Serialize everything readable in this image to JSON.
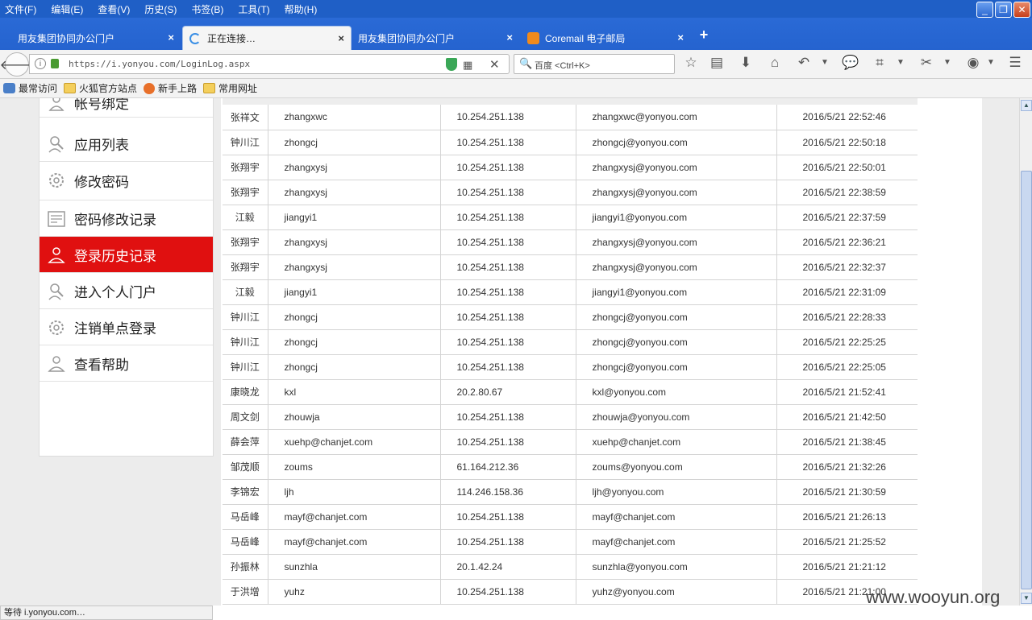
{
  "menu": [
    "文件(F)",
    "编辑(E)",
    "查看(V)",
    "历史(S)",
    "书签(B)",
    "工具(T)",
    "帮助(H)"
  ],
  "tabs": [
    {
      "label": "用友集团协同办公门户"
    },
    {
      "label": "正在连接…"
    },
    {
      "label": "用友集团协同办公门户"
    },
    {
      "label": "Coremail 电子邮局"
    }
  ],
  "tab_close": "×",
  "new_tab": "+",
  "nav": {
    "url": "https://i.yonyou.com/LoginLog.aspx",
    "search_placeholder": "百度 <Ctrl+K>"
  },
  "bookmarks": [
    "最常访问",
    "火狐官方站点",
    "新手上路",
    "常用网址"
  ],
  "sidebar": [
    {
      "label": "帐号绑定"
    },
    {
      "label": "应用列表"
    },
    {
      "label": "修改密码"
    },
    {
      "label": "密码修改记录"
    },
    {
      "label": "登录历史记录",
      "active": true
    },
    {
      "label": "进入个人门户"
    },
    {
      "label": "注销单点登录"
    },
    {
      "label": "查看帮助"
    }
  ],
  "log_rows": [
    [
      "张祥文",
      "zhangxwc",
      "10.254.251.138",
      "zhangxwc@yonyou.com",
      "2016/5/21 22:52:46"
    ],
    [
      "钟川江",
      "zhongcj",
      "10.254.251.138",
      "zhongcj@yonyou.com",
      "2016/5/21 22:50:18"
    ],
    [
      "张翔宇",
      "zhangxysj",
      "10.254.251.138",
      "zhangxysj@yonyou.com",
      "2016/5/21 22:50:01"
    ],
    [
      "张翔宇",
      "zhangxysj",
      "10.254.251.138",
      "zhangxysj@yonyou.com",
      "2016/5/21 22:38:59"
    ],
    [
      "江毅",
      "jiangyi1",
      "10.254.251.138",
      "jiangyi1@yonyou.com",
      "2016/5/21 22:37:59"
    ],
    [
      "张翔宇",
      "zhangxysj",
      "10.254.251.138",
      "zhangxysj@yonyou.com",
      "2016/5/21 22:36:21"
    ],
    [
      "张翔宇",
      "zhangxysj",
      "10.254.251.138",
      "zhangxysj@yonyou.com",
      "2016/5/21 22:32:37"
    ],
    [
      "江毅",
      "jiangyi1",
      "10.254.251.138",
      "jiangyi1@yonyou.com",
      "2016/5/21 22:31:09"
    ],
    [
      "钟川江",
      "zhongcj",
      "10.254.251.138",
      "zhongcj@yonyou.com",
      "2016/5/21 22:28:33"
    ],
    [
      "钟川江",
      "zhongcj",
      "10.254.251.138",
      "zhongcj@yonyou.com",
      "2016/5/21 22:25:25"
    ],
    [
      "钟川江",
      "zhongcj",
      "10.254.251.138",
      "zhongcj@yonyou.com",
      "2016/5/21 22:25:05"
    ],
    [
      "康晓龙",
      "kxl",
      "20.2.80.67",
      "kxl@yonyou.com",
      "2016/5/21 21:52:41"
    ],
    [
      "周文剑",
      "zhouwja",
      "10.254.251.138",
      "zhouwja@yonyou.com",
      "2016/5/21 21:42:50"
    ],
    [
      "薛会萍",
      "xuehp@chanjet.com",
      "10.254.251.138",
      "xuehp@chanjet.com",
      "2016/5/21 21:38:45"
    ],
    [
      "邹茂顺",
      "zoums",
      "61.164.212.36",
      "zoums@yonyou.com",
      "2016/5/21 21:32:26"
    ],
    [
      "李锦宏",
      "ljh",
      "114.246.158.36",
      "ljh@yonyou.com",
      "2016/5/21 21:30:59"
    ],
    [
      "马岳峰",
      "mayf@chanjet.com",
      "10.254.251.138",
      "mayf@chanjet.com",
      "2016/5/21 21:26:13"
    ],
    [
      "马岳峰",
      "mayf@chanjet.com",
      "10.254.251.138",
      "mayf@chanjet.com",
      "2016/5/21 21:25:52"
    ],
    [
      "孙振林",
      "sunzhla",
      "20.1.42.24",
      "sunzhla@yonyou.com",
      "2016/5/21 21:21:12"
    ],
    [
      "于洪增",
      "yuhz",
      "10.254.251.138",
      "yuhz@yonyou.com",
      "2016/5/21 21:21:00"
    ]
  ],
  "status": "等待 i.yonyou.com…",
  "watermark": "www.wooyun.org",
  "colors": {
    "titlebar": "#1f5fc6",
    "active_nav": "#e01010"
  }
}
